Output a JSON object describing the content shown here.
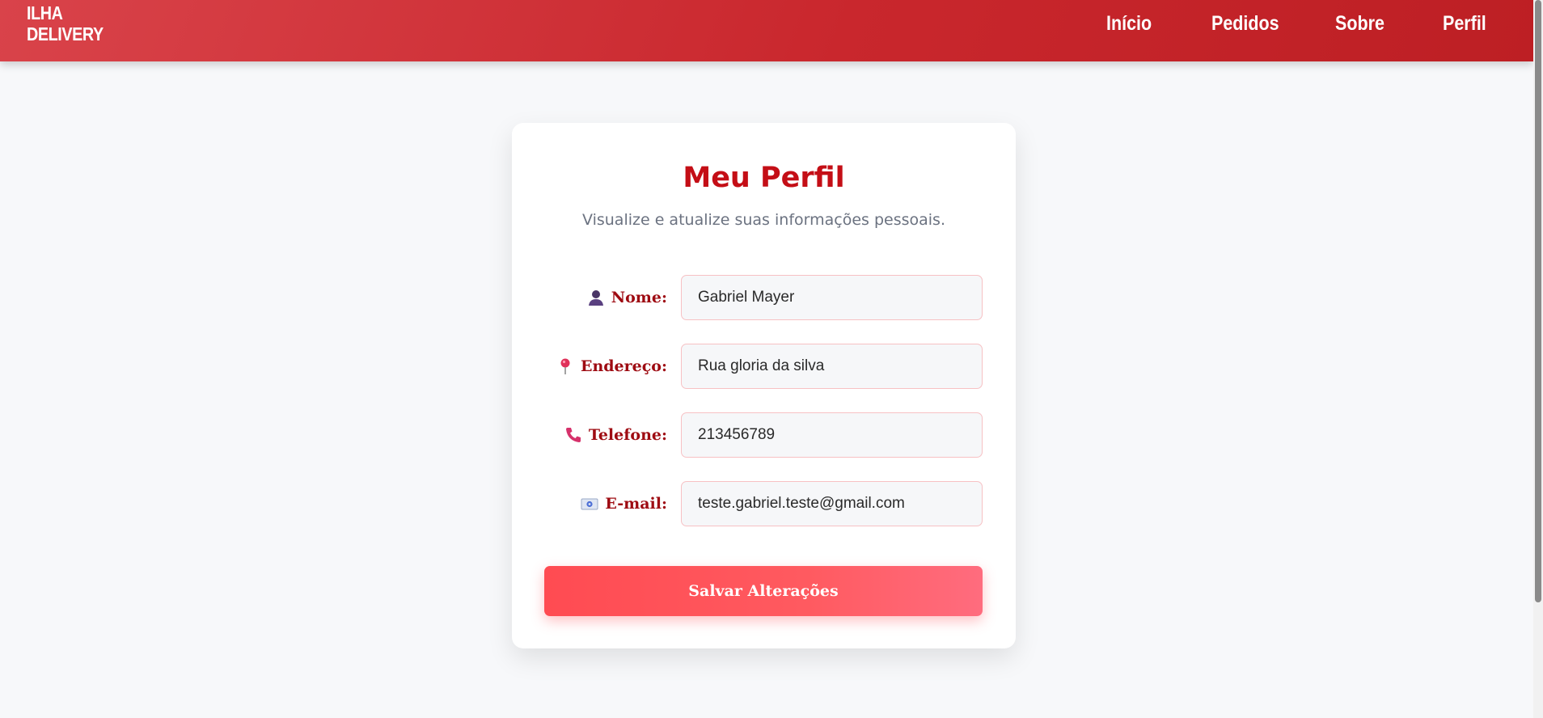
{
  "header": {
    "logo_line1": "ILHA",
    "logo_line2": "DELIVERY",
    "nav": [
      "Início",
      "Pedidos",
      "Sobre",
      "Perfil"
    ]
  },
  "profile": {
    "title": "Meu Perfil",
    "subtitle": "Visualize e atualize suas informações pessoais.",
    "fields": [
      {
        "label": "Nome:",
        "value": "Gabriel Mayer",
        "icon": "user-icon"
      },
      {
        "label": "Endereço:",
        "value": "Rua gloria da silva",
        "icon": "pin-icon"
      },
      {
        "label": "Telefone:",
        "value": "213456789",
        "icon": "phone-icon"
      },
      {
        "label": "E-mail:",
        "value": "teste.gabriel.teste@gmail.com",
        "icon": "email-icon"
      }
    ],
    "save_label": "Salvar Alterações"
  },
  "colors": {
    "header_start": "#d9434a",
    "header_end": "#bd1f24",
    "title": "#c40e16",
    "label": "#9e0b12",
    "button": "#ff4b52"
  }
}
